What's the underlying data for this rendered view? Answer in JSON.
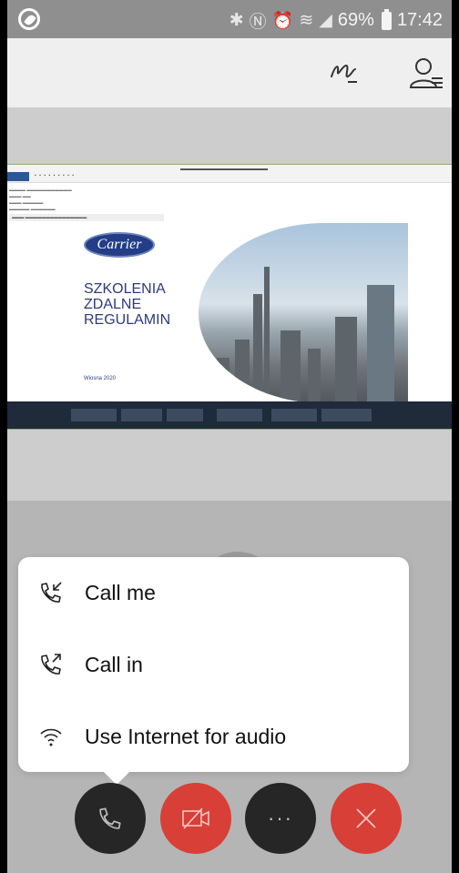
{
  "status_bar": {
    "battery_percent": "69%",
    "time": "17:42",
    "icons": [
      "bluetooth-icon",
      "nfc-icon",
      "alarm-icon",
      "wifi-icon",
      "signal-icon",
      "battery-icon"
    ]
  },
  "header": {
    "icons": [
      "annotate-icon",
      "participants-icon"
    ]
  },
  "shared_screen": {
    "slide_lines": [
      "SZKOLENIA",
      "ZDALNE",
      "REGULAMIN"
    ],
    "logo_text": "Carrier",
    "slide_date": "Wiosna 2020"
  },
  "audio_menu": {
    "options": [
      {
        "label": "Call me",
        "icon": "call-me-icon"
      },
      {
        "label": "Call in",
        "icon": "call-in-icon"
      },
      {
        "label": "Use Internet for audio",
        "icon": "internet-audio-icon"
      }
    ]
  },
  "controls": {
    "more_label": "···",
    "icons": [
      "phone-icon",
      "video-off-icon",
      "more-icon",
      "leave-icon"
    ],
    "colors": {
      "dark": "#262626",
      "red": "#d73f37"
    }
  }
}
